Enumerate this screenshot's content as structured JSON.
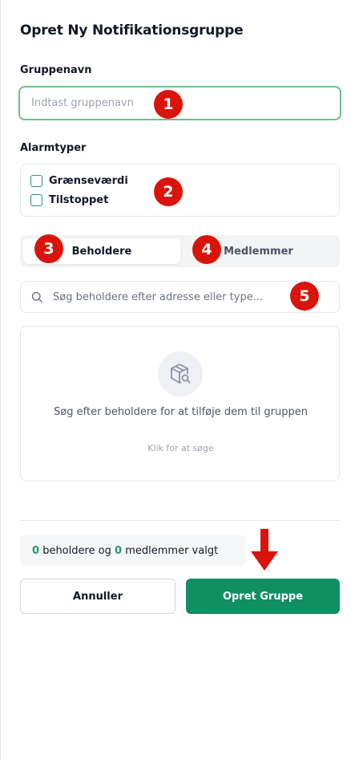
{
  "form": {
    "title": "Opret Ny Notifikationsgruppe",
    "group_name_label": "Gruppenavn",
    "group_name_placeholder": "Indtast gruppenavn",
    "group_name_value": "",
    "alarm_types_label": "Alarmtyper",
    "alarm_types": [
      {
        "label": "Grænseværdi",
        "checked": false
      },
      {
        "label": "Tilstoppet",
        "checked": false
      }
    ]
  },
  "tabs": [
    {
      "label": "Beholdere",
      "active": true
    },
    {
      "label": "Medlemmer",
      "active": false
    }
  ],
  "search": {
    "placeholder": "Søg beholdere efter adresse eller type...",
    "icon": "search-icon"
  },
  "empty_state": {
    "icon": "package-search-icon",
    "message": "Søg efter beholdere for at tilføje dem til gruppen",
    "link": "Klik for at søge"
  },
  "summary": {
    "containers_count": "0",
    "containers_text": "beholdere og",
    "members_count": "0",
    "members_text": "medlemmer valgt"
  },
  "buttons": {
    "cancel": "Annuller",
    "create": "Opret Gruppe"
  },
  "annotations": {
    "badges": [
      "1",
      "2",
      "3",
      "4",
      "5"
    ],
    "badge_color": "#d9140d",
    "arrow_color": "#d9140d"
  },
  "colors": {
    "accent": "#0f8f62",
    "focus_border": "#6cc08a"
  }
}
